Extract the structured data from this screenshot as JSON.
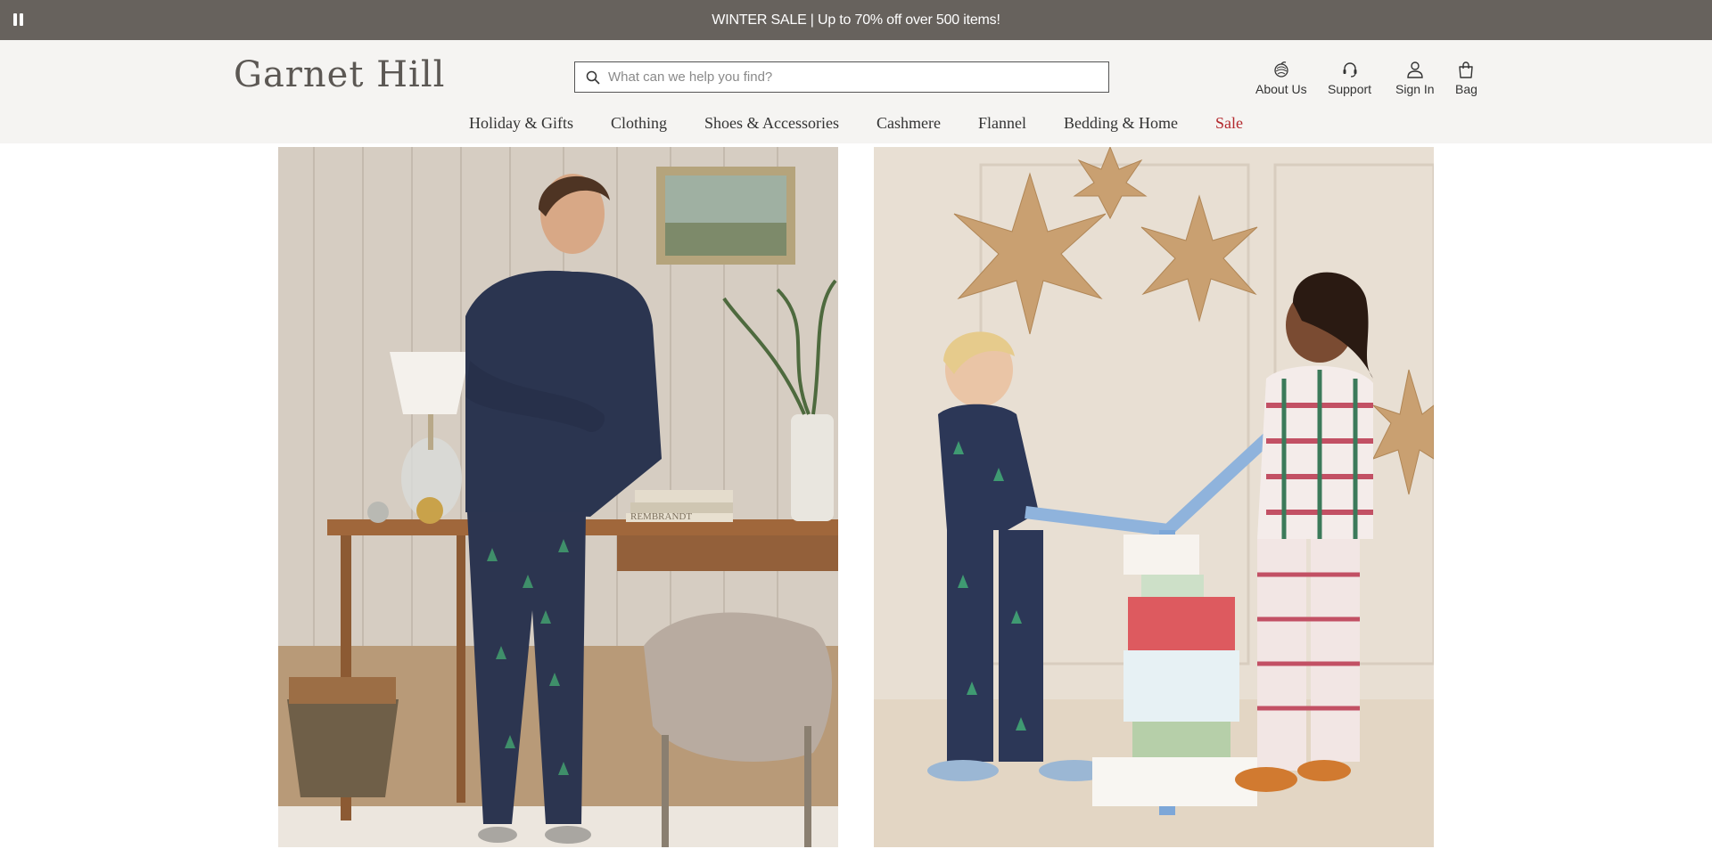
{
  "promo": {
    "text": "WINTER SALE | Up to 70% off over 500 items!",
    "pause_icon": "pause-icon"
  },
  "header": {
    "logo": "Garnet Hill",
    "search": {
      "placeholder": "What can we help you find?",
      "value": "",
      "icon": "search-icon"
    },
    "utilities": [
      {
        "label": "About Us",
        "icon": "garnet-logo-icon"
      },
      {
        "label": "Support",
        "icon": "headset-icon"
      },
      {
        "label": "Sign In",
        "icon": "user-icon"
      },
      {
        "label": "Bag",
        "icon": "shopping-bag-icon"
      }
    ],
    "nav": [
      {
        "label": "Holiday & Gifts"
      },
      {
        "label": "Clothing"
      },
      {
        "label": "Shoes & Accessories"
      },
      {
        "label": "Cashmere"
      },
      {
        "label": "Flannel"
      },
      {
        "label": "Bedding & Home"
      },
      {
        "label": "Sale"
      }
    ]
  },
  "colors": {
    "promo_bg": "#67625d",
    "header_bg": "#f5f4f2",
    "sale_red": "#b3282d",
    "navy": "#2c3550"
  },
  "hero": {
    "left": {
      "book_spine_text": "REMBRANDT"
    },
    "right": {}
  }
}
